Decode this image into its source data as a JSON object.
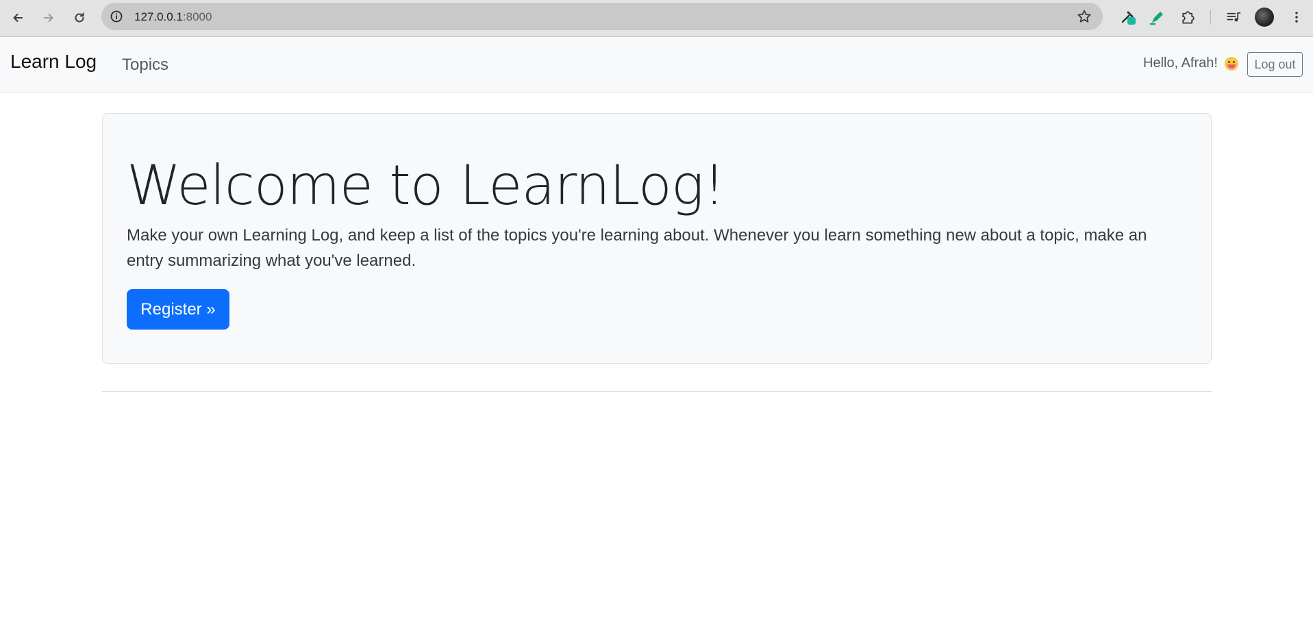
{
  "browser": {
    "url_host": "127.0.0.1",
    "url_port": ":8000",
    "icons": {
      "back": "back-arrow-icon",
      "forward": "forward-arrow-icon",
      "reload": "reload-icon",
      "info": "site-info-icon",
      "bookmark": "bookmark-star-icon",
      "extensions": [
        "eyedropper-extension-icon",
        "highlighter-extension-icon",
        "puzzle-extensions-icon",
        "media-controls-icon"
      ],
      "menu": "kebab-menu-icon"
    }
  },
  "navbar": {
    "brand": "Learn Log",
    "links": [
      {
        "label": "Topics"
      }
    ],
    "greeting": "Hello, Afrah!",
    "logout_label": "Log out"
  },
  "hero": {
    "title": "Welcome to LearnLog!",
    "lead": "Make your own Learning Log, and keep a list of the topics you're learning about. Whenever you learn something new about a topic, make an entry summarizing what you've learned.",
    "register_label": "Register »"
  },
  "colors": {
    "primary": "#0d6efd",
    "navbar_bg": "#f8f9fa",
    "chrome_bg": "#e3e3e3"
  }
}
